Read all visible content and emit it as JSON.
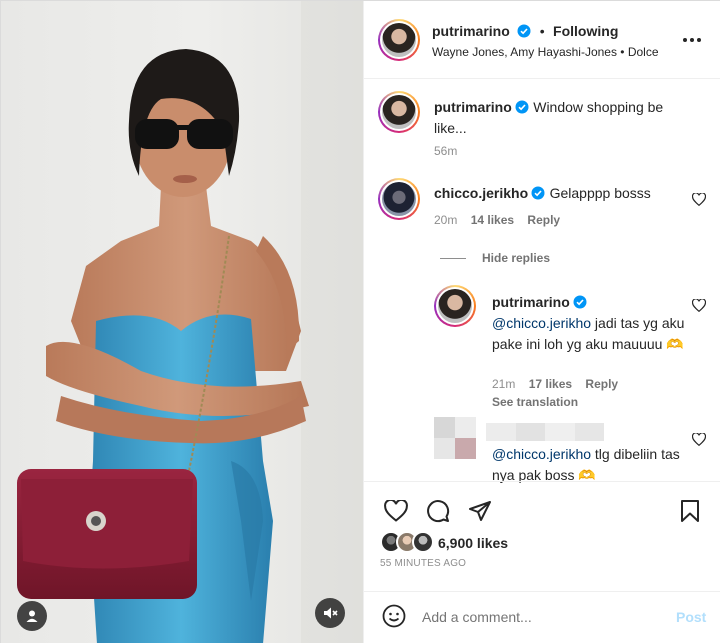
{
  "post": {
    "username": "putrimarino",
    "follow_status": "Following",
    "separator": "•",
    "collaborators": "Wayne Jones, Amy Hayashi-Jones • Dolce",
    "more_icon": "more-horizontal-icon"
  },
  "caption": {
    "username": "putrimarino",
    "text": "Window shopping be like...",
    "time": "56m"
  },
  "comments": [
    {
      "username": "chicco.jerikho",
      "text": "Gelapppp bosss",
      "time": "20m",
      "likes": "14 likes",
      "reply": "Reply"
    }
  ],
  "hide_replies": "Hide replies",
  "replies": [
    {
      "username": "putrimarino",
      "mention": "@chicco.jerikho",
      "text": " jadi tas yg aku pake ini loh yg aku mauuuu 🫶",
      "time": "21m",
      "likes": "17 likes",
      "reply": "Reply",
      "translation": "See translation"
    },
    {
      "mention": "@chicco.jerikho",
      "text": " tlg dibeliin tas nya pak boss 🫶"
    }
  ],
  "actions": {
    "likes": "6,900 likes",
    "timestamp": "55 MINUTES AGO"
  },
  "add_comment": {
    "placeholder": "Add a comment...",
    "post_label": "Post"
  },
  "colors": {
    "verified": "#0095f6",
    "post_disabled": "#b2dffc",
    "dress": "#3a9cc9",
    "bag": "#8a1c34"
  }
}
